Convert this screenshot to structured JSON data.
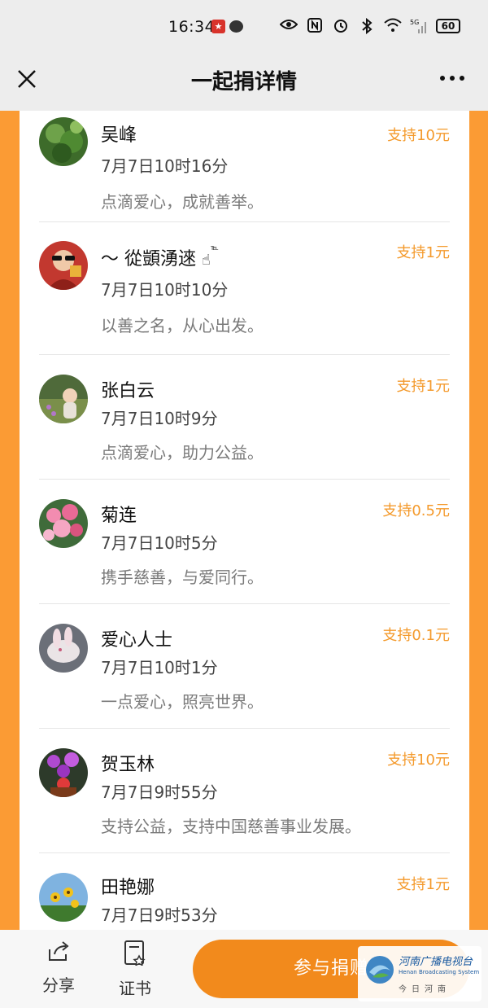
{
  "status_bar": {
    "time": "16:34",
    "battery": "60",
    "signal_label": "5G",
    "icons": [
      "eye-icon",
      "nfc-icon",
      "alarm-icon",
      "bluetooth-icon",
      "wifi-icon",
      "signal-icon",
      "battery-icon"
    ]
  },
  "nav": {
    "title": "一起捐详情",
    "close_icon": "close-icon",
    "more_icon": "more-icon"
  },
  "colors": {
    "accent": "#fb9b34",
    "amount": "#f49a2c",
    "button": "#f28a1c"
  },
  "donors": [
    {
      "name": "吴峰",
      "time": "7月7日10时16分",
      "message": "点滴爱心，成就善举。",
      "amount": "支持10元"
    },
    {
      "name": "～  從顗湧逨",
      "time": "7月7日10时10分",
      "message": "以善之名，从心出发。",
      "amount": "支持1元"
    },
    {
      "name": "张白云",
      "time": "7月7日10时9分",
      "message": "点滴爱心，助力公益。",
      "amount": "支持1元"
    },
    {
      "name": "菊连",
      "time": "7月7日10时5分",
      "message": "携手慈善，与爱同行。",
      "amount": "支持0.5元"
    },
    {
      "name": "爱心人士",
      "time": "7月7日10时1分",
      "message": "一点爱心，照亮世界。",
      "amount": "支持0.1元"
    },
    {
      "name": "贺玉林",
      "time": "7月7日9时55分",
      "message": "支持公益，支持中国慈善事业发展。",
      "amount": "支持10元"
    },
    {
      "name": "田艳娜",
      "time": "7月7日9时53分",
      "message": "",
      "amount": "支持1元"
    }
  ],
  "bottom_bar": {
    "share_label": "分享",
    "certificate_label": "证书",
    "donate_label": "参与捐赠"
  },
  "watermark": {
    "cn": "河南广播电视台",
    "en": "Henan Broadcasting System",
    "sub": "今日河南"
  }
}
